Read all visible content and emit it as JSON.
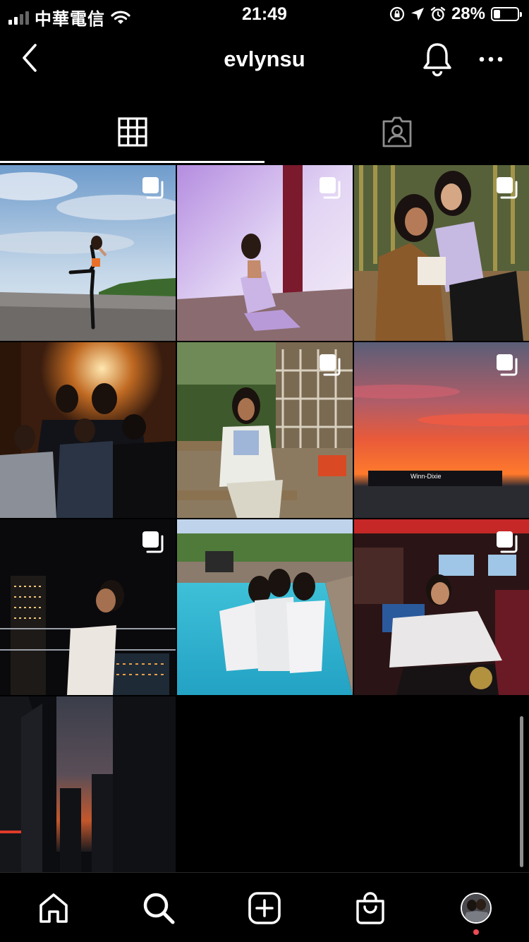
{
  "status_bar": {
    "carrier": "中華電信",
    "time": "21:49",
    "battery_percent": "28%",
    "battery_level": 0.28,
    "icons": [
      "signal-icon",
      "wifi-icon",
      "orientation-lock-icon",
      "location-arrow-icon",
      "alarm-icon",
      "battery-icon"
    ]
  },
  "header": {
    "username": "evlynsu",
    "icons": [
      "back-chevron-icon",
      "bell-icon",
      "more-icon"
    ]
  },
  "tabs": [
    {
      "name": "posts-grid",
      "icon": "grid-icon",
      "active": true
    },
    {
      "name": "tagged",
      "icon": "tagged-person-icon",
      "active": false
    }
  ],
  "posts": [
    {
      "scene": "beach-jump",
      "multiple": true
    },
    {
      "scene": "purple-studio",
      "multiple": true
    },
    {
      "scene": "bamboo-friends",
      "multiple": true
    },
    {
      "scene": "group-bar",
      "multiple": false
    },
    {
      "scene": "garden-sitting",
      "multiple": true
    },
    {
      "scene": "sunset-sky",
      "multiple": true,
      "sign_text": "Winn-Dixie"
    },
    {
      "scene": "night-city-balcony",
      "multiple": true
    },
    {
      "scene": "pool-robes",
      "multiple": false
    },
    {
      "scene": "restaurant-hoodie",
      "multiple": true
    },
    {
      "scene": "city-dusk",
      "multiple": false
    }
  ],
  "bottom_nav": [
    {
      "name": "home",
      "icon": "home-icon"
    },
    {
      "name": "search",
      "icon": "search-icon"
    },
    {
      "name": "new-post",
      "icon": "plus-square-icon"
    },
    {
      "name": "shop",
      "icon": "shopping-bag-icon"
    },
    {
      "name": "profile",
      "icon": "profile-avatar",
      "has_notification_dot": true
    }
  ],
  "colors": {
    "background": "#000000",
    "foreground": "#ffffff",
    "notification": "#ed4956"
  }
}
